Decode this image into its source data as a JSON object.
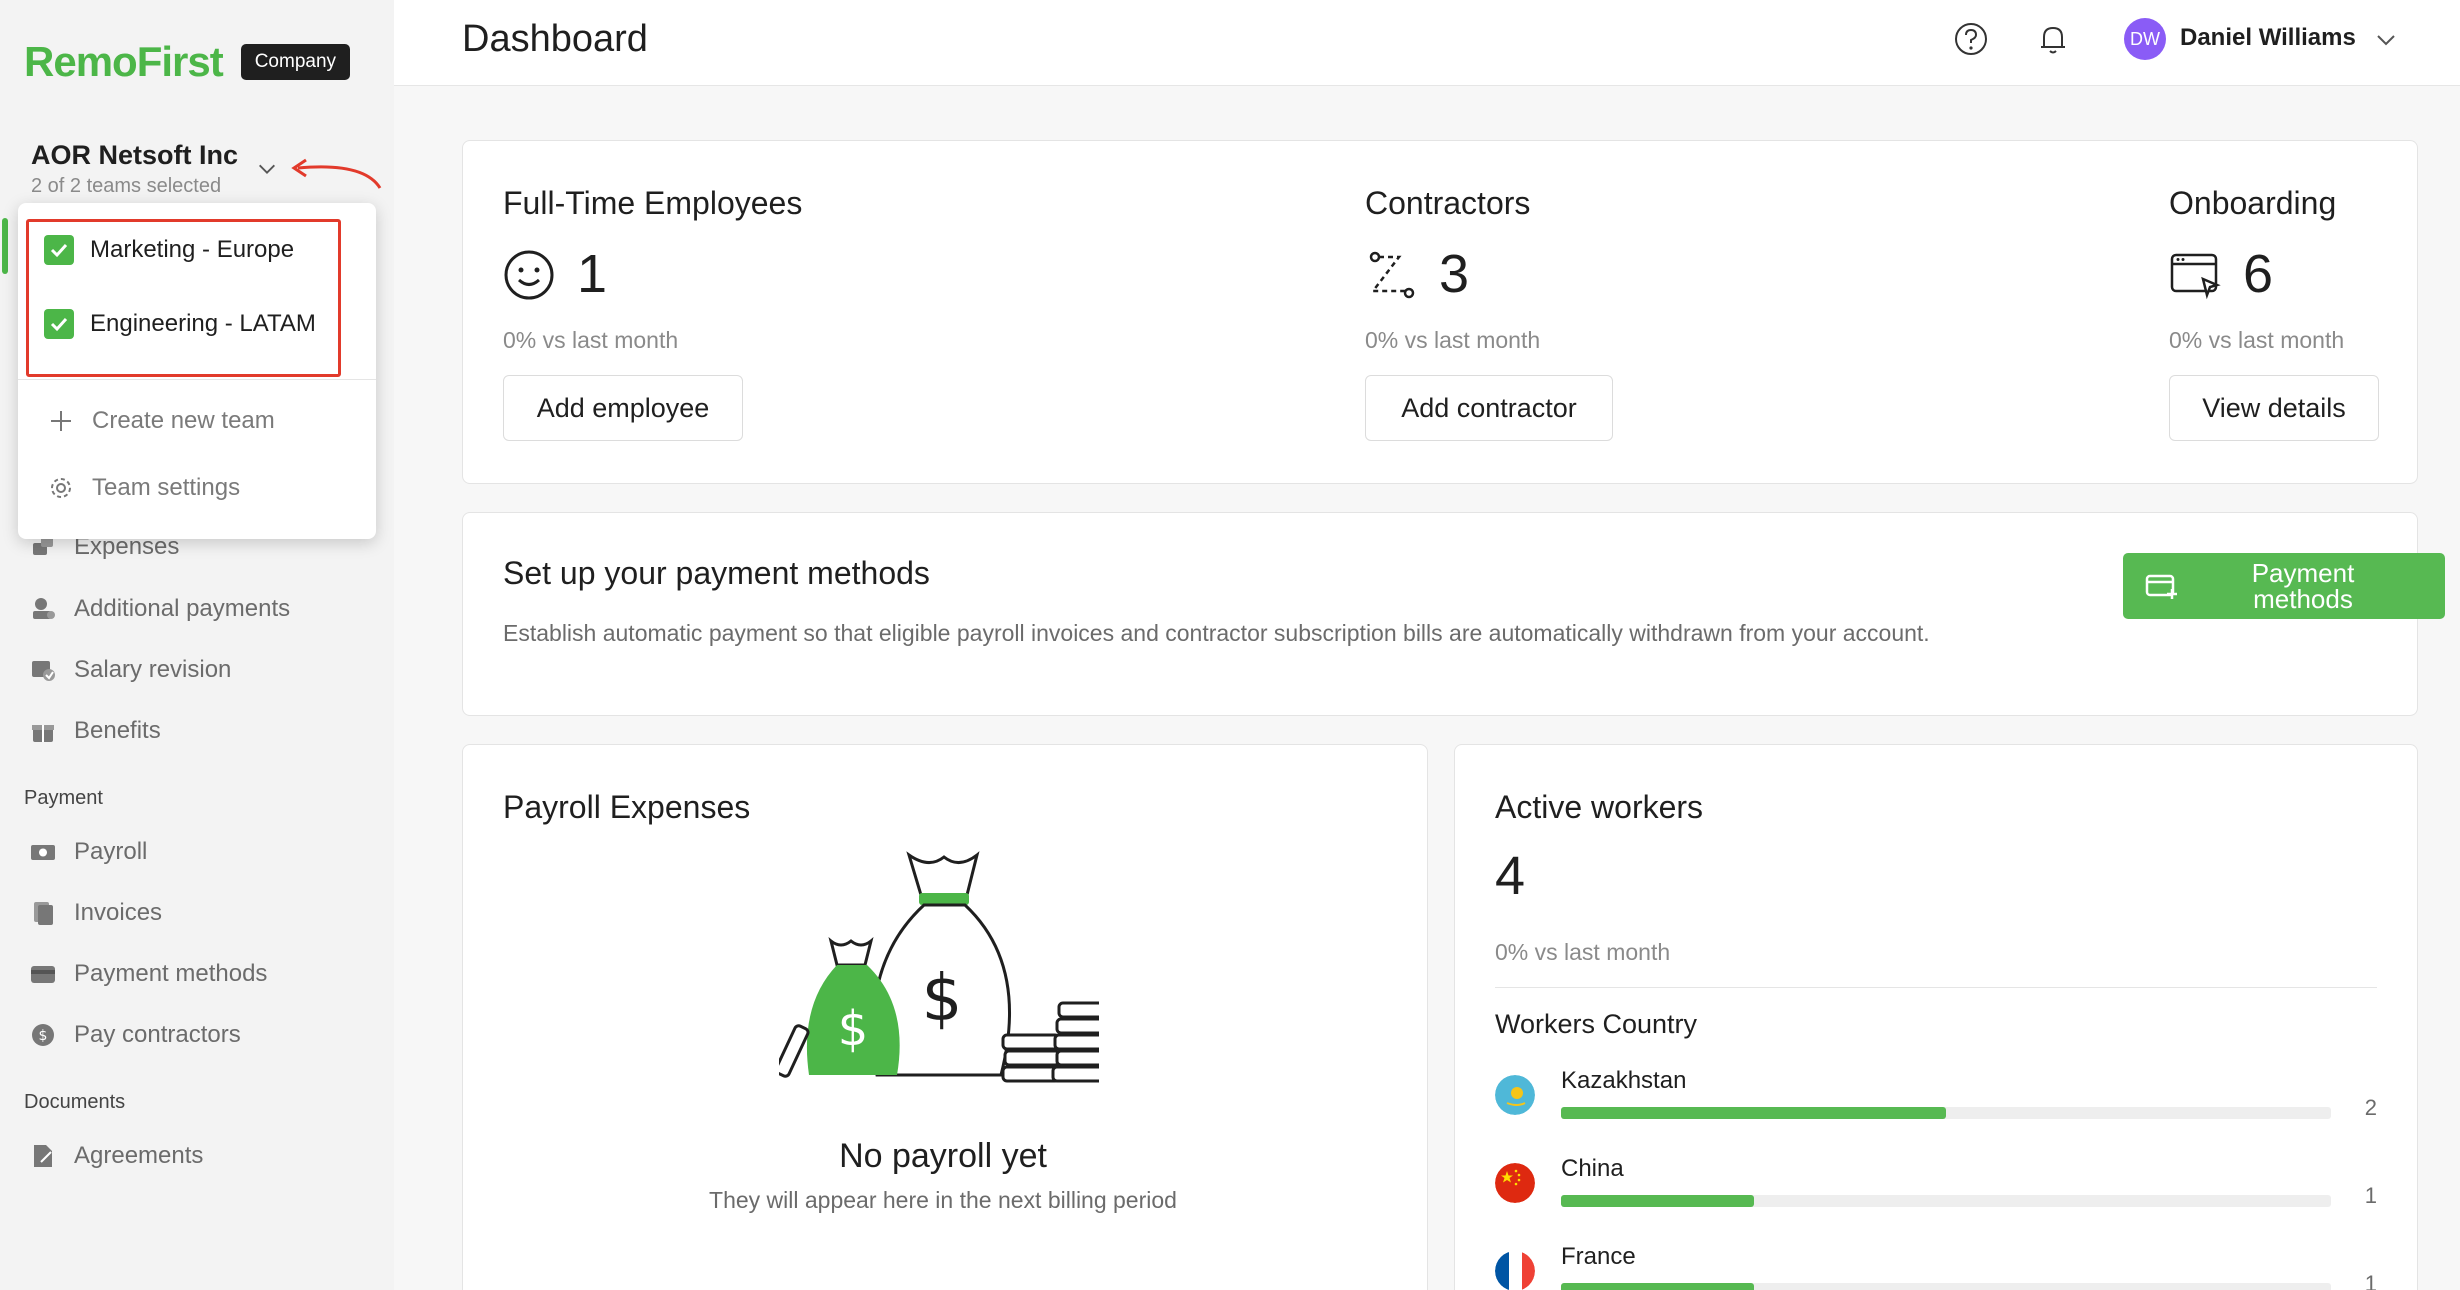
{
  "brand": {
    "logo": "RemoFirst",
    "badge": "Company",
    "green": "#4cb648",
    "dark": "#1f1f1f"
  },
  "org": {
    "name": "AOR Netsoft Inc",
    "teams_selected": "2 of 2 teams selected"
  },
  "team_dropdown": {
    "teams": [
      {
        "label": "Marketing - Europe",
        "checked": true
      },
      {
        "label": "Engineering - LATAM",
        "checked": true
      }
    ],
    "actions": [
      {
        "label": "Create new team",
        "icon": "plus-icon"
      },
      {
        "label": "Team settings",
        "icon": "gear-icon"
      }
    ]
  },
  "sidebar": {
    "items_top": [
      {
        "label": "Expenses",
        "icon": "expenses-icon"
      },
      {
        "label": "Additional payments",
        "icon": "additional-payments-icon"
      },
      {
        "label": "Salary revision",
        "icon": "salary-revision-icon"
      },
      {
        "label": "Benefits",
        "icon": "gift-icon"
      }
    ],
    "payment_section": "Payment",
    "payment_items": [
      {
        "label": "Payroll",
        "icon": "payroll-icon"
      },
      {
        "label": "Invoices",
        "icon": "invoices-icon"
      },
      {
        "label": "Payment methods",
        "icon": "card-icon"
      },
      {
        "label": "Pay contractors",
        "icon": "dollar-coin-icon"
      }
    ],
    "documents_section": "Documents",
    "documents_items": [
      {
        "label": "Agreements",
        "icon": "agreements-icon"
      }
    ]
  },
  "header": {
    "title": "Dashboard",
    "user": {
      "initials": "DW",
      "name": "Daniel Williams",
      "avatar_color": "#8a5cf6"
    }
  },
  "stats": [
    {
      "title": "Full-Time Employees",
      "value": "1",
      "delta": "0%   vs last month",
      "button": "Add employee",
      "icon": "smiley-icon"
    },
    {
      "title": "Contractors",
      "value": "3",
      "delta": "0%   vs last month",
      "button": "Add contractor",
      "icon": "route-icon"
    },
    {
      "title": "Onboarding",
      "value": "6",
      "delta": "0%   vs last month",
      "button": "View details",
      "icon": "browser-cursor-icon"
    }
  ],
  "payment_setup": {
    "title": "Set up your payment methods",
    "description": "Establish automatic payment so that eligible payroll invoices and contractor subscription bills are automatically withdrawn from your account.",
    "button": "Payment methods"
  },
  "payroll_expenses": {
    "title": "Payroll Expenses",
    "empty_title": "No payroll yet",
    "empty_subtitle": "They will appear here in the next billing period"
  },
  "active_workers": {
    "title": "Active workers",
    "value": "4",
    "delta": "0%   vs last month",
    "countries_title": "Workers Country",
    "countries": [
      {
        "name": "Kazakhstan",
        "count": "2",
        "share": 0.5
      },
      {
        "name": "China",
        "count": "1",
        "share": 0.25
      },
      {
        "name": "France",
        "count": "1",
        "share": 0.25
      }
    ]
  }
}
